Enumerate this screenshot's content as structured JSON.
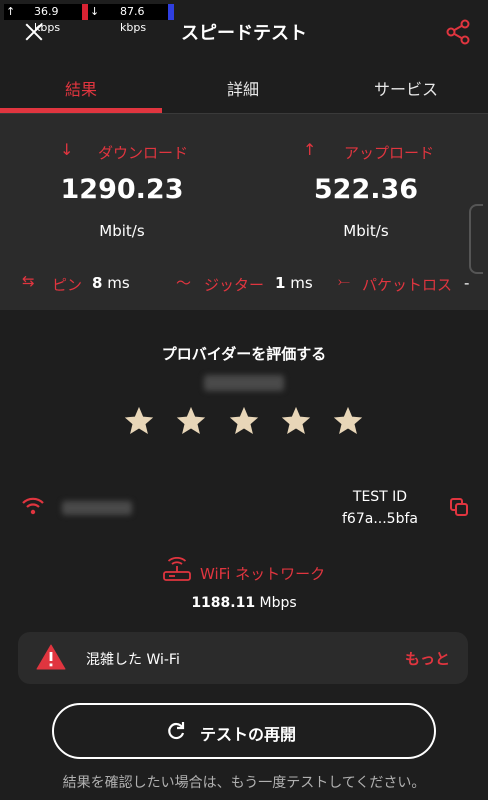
{
  "status_bar": {
    "upload_speed": "36.9 kbps",
    "download_speed": "87.6 kbps",
    "up_arrow": "↑",
    "down_arrow": "↓"
  },
  "header": {
    "title": "スピードテスト"
  },
  "tabs": [
    {
      "label": "結果",
      "active": true
    },
    {
      "label": "詳細",
      "active": false
    },
    {
      "label": "サービス",
      "active": false
    }
  ],
  "results": {
    "download": {
      "label": "ダウンロード",
      "value": "1290.23",
      "unit": "Mbit/s"
    },
    "upload": {
      "label": "アップロード",
      "value": "522.36",
      "unit": "Mbit/s"
    },
    "ping": {
      "label": "ピン",
      "value": "8",
      "unit": "ms"
    },
    "jitter": {
      "label": "ジッター",
      "value": "1",
      "unit": "ms"
    },
    "packet_loss": {
      "label": "パケットロス",
      "value": "-"
    }
  },
  "rating": {
    "title": "プロバイダーを評価する",
    "stars": 5
  },
  "info": {
    "test_id_label": "TEST ID",
    "test_id_value": "f67a...5bfa",
    "network_label": "WiFi ネットワーク",
    "network_speed": "1188.11",
    "network_speed_unit": "Mbps"
  },
  "alert": {
    "text": "混雑した Wi-Fi",
    "more": "もっと"
  },
  "restart": {
    "label": "テストの再開"
  },
  "footnote": "結果を確認したい場合は、もう一度テストしてください。",
  "colors": {
    "accent": "#e0353f",
    "background": "#1e1e1e",
    "panel": "#2b2b2b",
    "star": "#e8d6b8"
  }
}
